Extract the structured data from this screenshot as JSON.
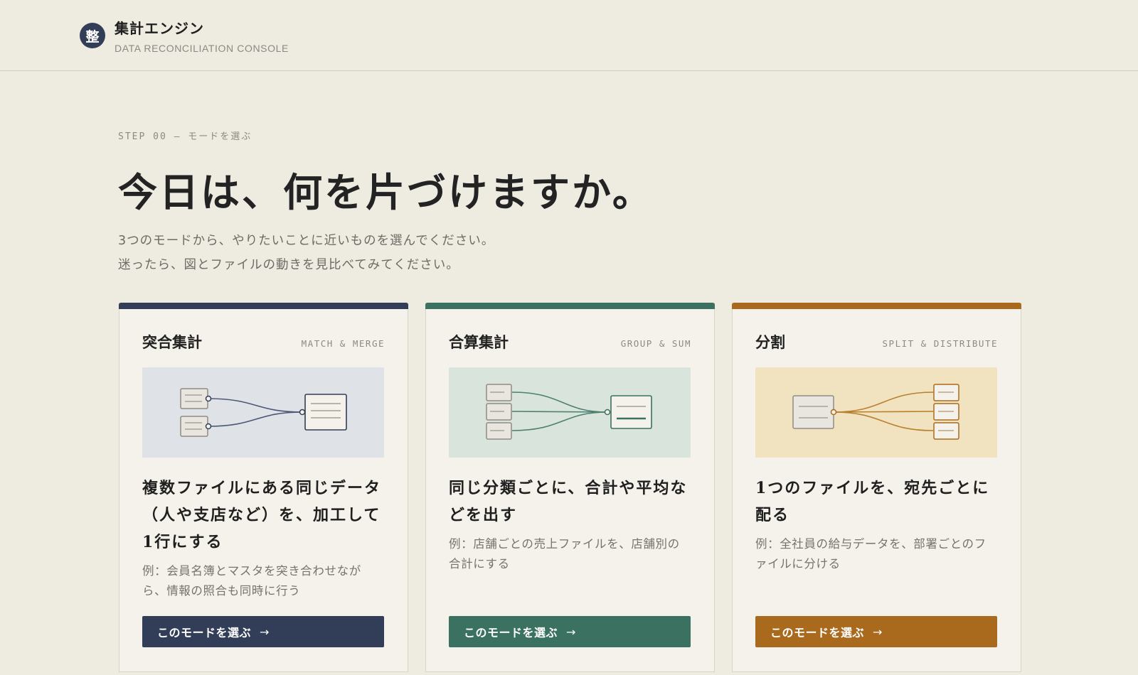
{
  "header": {
    "logo_glyph": "整",
    "app_title": "集計エンジン",
    "app_subtitle": "DATA RECONCILIATION CONSOLE"
  },
  "intro": {
    "eyebrow": "STEP 00 — モードを選ぶ",
    "headline": "今日は、何を片づけますか。",
    "lead_line1": "3つのモードから、やりたいことに近いものを選んでください。",
    "lead_line2": "迷ったら、図とファイルの動きを見比べてみてください。"
  },
  "modes": [
    {
      "title": "突合集計",
      "tag": "MATCH & MERGE",
      "heading": "複数ファイルにある同じデータ（人や支店など）を、加工して1行にする",
      "example": "例：会員名簿とマスタを突き合わせながら、情報の照合も同時に行う",
      "button_label": "このモードを選ぶ",
      "button_arrow": "→",
      "accent_color": "#323d58",
      "diagram_bg": "#dfe2e6",
      "diagram_icon": "match-merge-diagram"
    },
    {
      "title": "合算集計",
      "tag": "GROUP & SUM",
      "heading": "同じ分類ごとに、合計や平均などを出す",
      "example": "例：店舗ごとの売上ファイルを、店舗別の合計にする",
      "button_label": "このモードを選ぶ",
      "button_arrow": "→",
      "accent_color": "#3a7160",
      "diagram_bg": "#d8e4dc",
      "diagram_icon": "group-sum-diagram"
    },
    {
      "title": "分割",
      "tag": "SPLIT & DISTRIBUTE",
      "heading": "1つのファイルを、宛先ごとに配る",
      "example": "例：全社員の給与データを、部署ごとのファイルに分ける",
      "button_label": "このモードを選ぶ",
      "button_arrow": "→",
      "accent_color": "#a96a1d",
      "diagram_bg": "#f1e3bf",
      "diagram_icon": "split-distribute-diagram"
    }
  ]
}
